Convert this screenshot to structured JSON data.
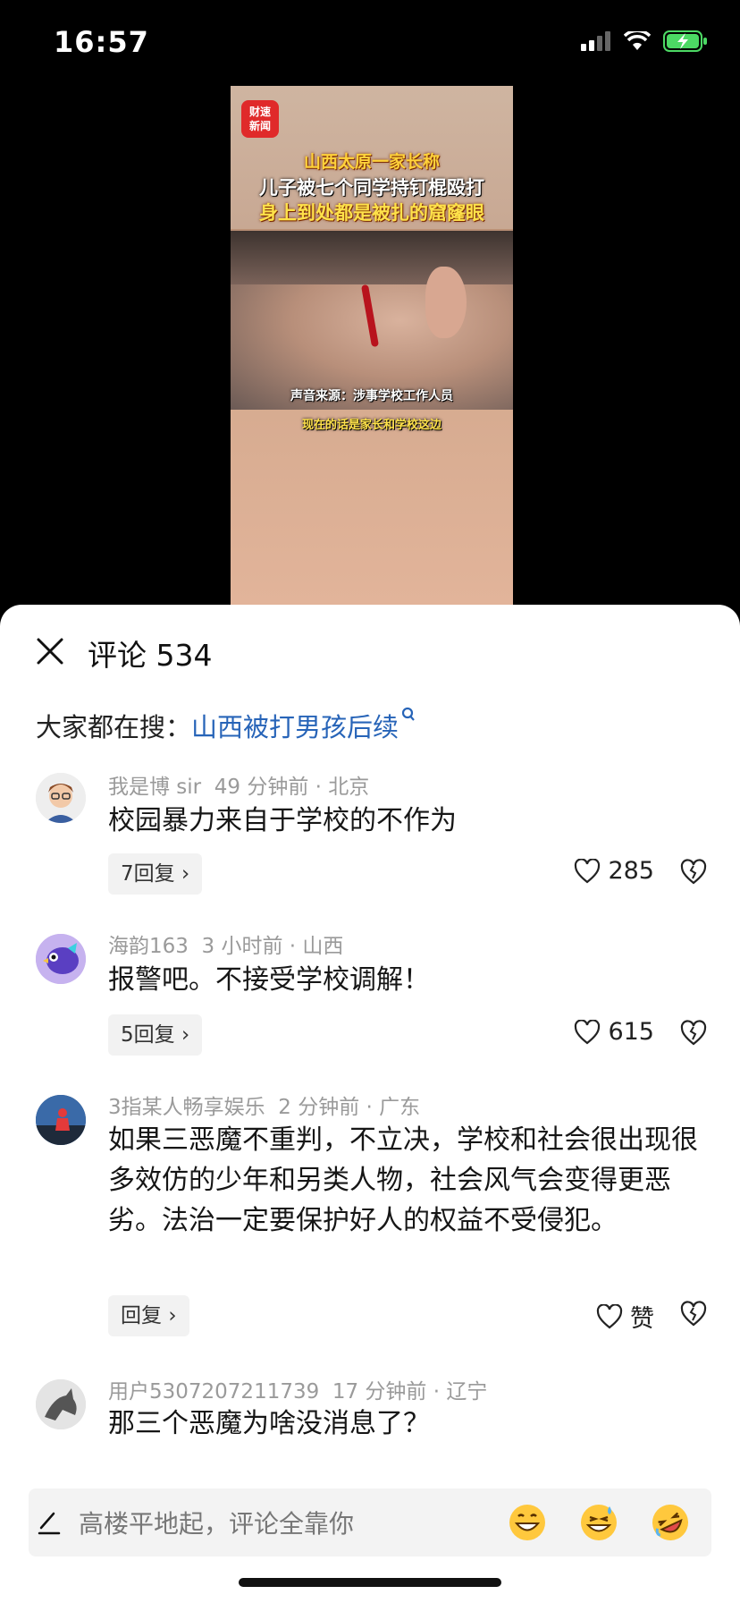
{
  "status_bar": {
    "time": "16:57"
  },
  "video": {
    "logo_line1": "财速",
    "logo_line2": "新闻",
    "title_line1": "山西太原一家长称",
    "title_line2": "儿子被七个同学持钉棍殴打",
    "title_line3": "身上到处都是被扎的窟窿眼",
    "caption1": "声音来源：涉事学校工作人员",
    "caption2": "现在的话是家长和学校这边"
  },
  "sheet": {
    "title": "评论 534",
    "search_prefix": "大家都在搜：",
    "search_term": "山西被打男孩后续"
  },
  "comments": [
    {
      "user": "我是博 sir",
      "time": "49 分钟前",
      "location": "北京",
      "text": "校园暴力来自于学校的不作为",
      "replies": "7回复",
      "likes": "285"
    },
    {
      "user": "海韵163",
      "time": "3 小时前",
      "location": "山西",
      "text": "报警吧。不接受学校调解！",
      "replies": "5回复",
      "likes": "615"
    },
    {
      "user": "3指某人畅享娱乐",
      "time": "2 分钟前",
      "location": "广东",
      "text": "如果三恶魔不重判，不立决，学校和社会很出现很多效仿的少年和另类人物，社会风气会变得更恶劣。法治一定要保护好人的权益不受侵犯。",
      "replies": "回复",
      "likes": "赞"
    },
    {
      "user": "用户5307207211739",
      "time": "17 分钟前",
      "location": "辽宁",
      "text": "那三个恶魔为啥没消息了？"
    }
  ],
  "input": {
    "placeholder": "高楼平地起，评论全靠你"
  },
  "emojis": [
    "grinning-face",
    "grinning-sweat-face",
    "rolling-laughing-face"
  ]
}
